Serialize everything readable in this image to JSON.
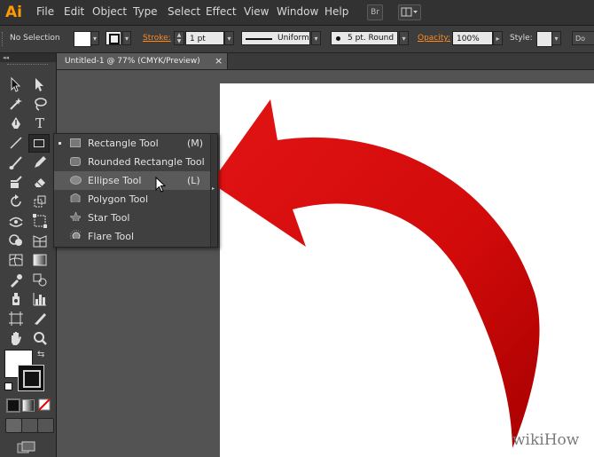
{
  "app": {
    "logo": "Ai"
  },
  "menubar": {
    "items": [
      "File",
      "Edit",
      "Object",
      "Type",
      "Select",
      "Effect",
      "View",
      "Window",
      "Help"
    ],
    "bridge_label": "Br"
  },
  "controlbar": {
    "selection": "No Selection",
    "stroke_label": "Stroke:",
    "stroke_value": "1 pt",
    "profile": "Uniform",
    "brush": "5 pt. Round",
    "opacity_label": "Opacity:",
    "opacity_value": "100%",
    "style_label": "Style:",
    "doc_setup_label": "Do"
  },
  "document": {
    "tab_title": "Untitled-1 @ 77% (CMYK/Preview)",
    "close_glyph": "×"
  },
  "flyout": {
    "items": [
      {
        "label": "Rectangle Tool",
        "key": "(M)",
        "icon": "rectangle-icon",
        "current": true,
        "highlighted": false
      },
      {
        "label": "Rounded Rectangle Tool",
        "key": "",
        "icon": "rounded-rectangle-icon",
        "current": false,
        "highlighted": false
      },
      {
        "label": "Ellipse Tool",
        "key": "(L)",
        "icon": "ellipse-icon",
        "current": false,
        "highlighted": true
      },
      {
        "label": "Polygon Tool",
        "key": "",
        "icon": "polygon-icon",
        "current": false,
        "highlighted": false
      },
      {
        "label": "Star Tool",
        "key": "",
        "icon": "star-icon",
        "current": false,
        "highlighted": false
      },
      {
        "label": "Flare Tool",
        "key": "",
        "icon": "flare-icon",
        "current": false,
        "highlighted": false
      }
    ]
  },
  "artwork": {
    "arrow_color": "#d90c0c",
    "arrow_dark": "#b00000"
  },
  "watermark": "wikiHow"
}
